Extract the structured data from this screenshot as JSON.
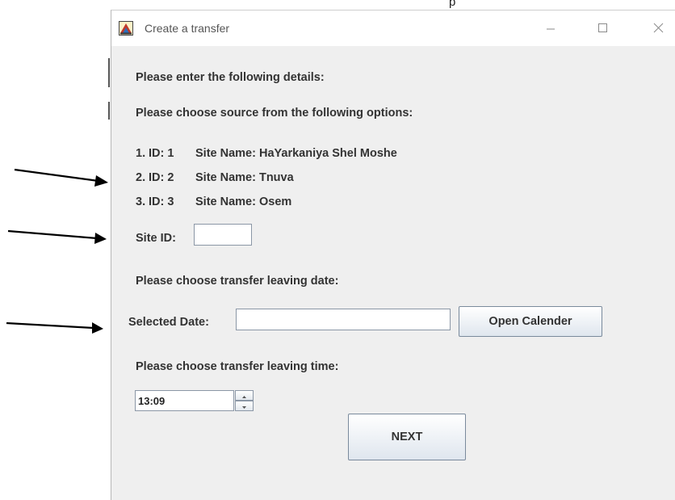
{
  "window": {
    "title": "Create a transfer",
    "controls": {
      "minimize": "minimize",
      "maximize": "maximize",
      "close": "close"
    }
  },
  "form": {
    "intro_label": "Please enter the following details:",
    "source_prompt": "Please choose source from the following options:",
    "sites": [
      {
        "number": "1.",
        "id_label": "ID: 1",
        "name_label": "Site Name: HaYarkaniya Shel Moshe"
      },
      {
        "number": "2.",
        "id_label": "ID: 2",
        "name_label": "Site Name: Tnuva"
      },
      {
        "number": "3.",
        "id_label": "ID: 3",
        "name_label": "Site Name: Osem"
      }
    ],
    "site_id_label": "Site ID:",
    "site_id_value": "",
    "date_prompt": "Please choose transfer leaving date:",
    "selected_date_label": "Selected Date:",
    "selected_date_value": "",
    "open_calendar_label": "Open Calender",
    "time_prompt": "Please choose transfer leaving time:",
    "time_value": "13:09",
    "next_label": "NEXT"
  },
  "colors": {
    "window_bg": "#efefef",
    "title_bar_bg": "#ffffff",
    "label_text": "#333333",
    "arrow": "#000000"
  }
}
